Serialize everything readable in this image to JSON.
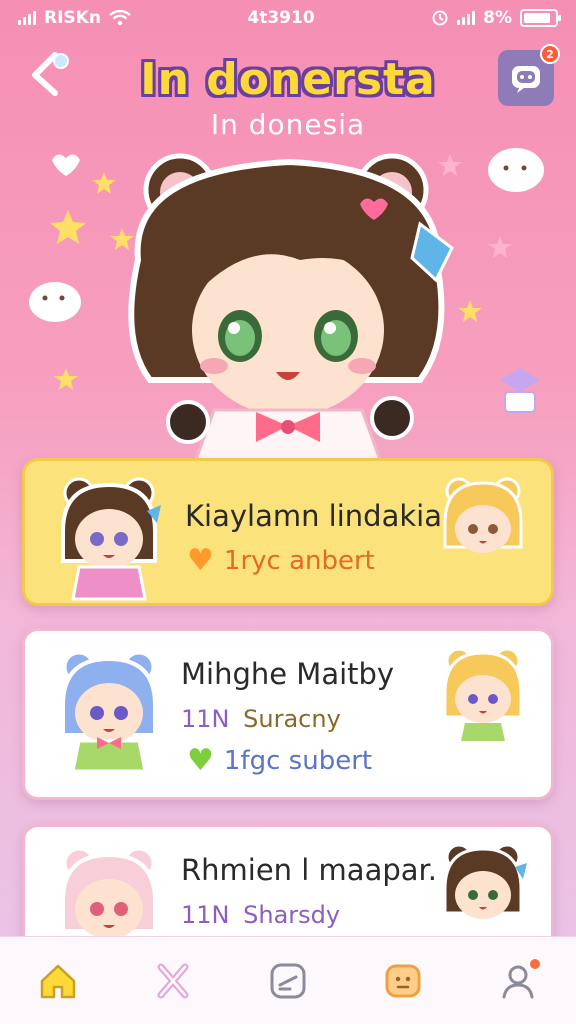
{
  "status_bar": {
    "carrier": "RISKn",
    "time": "4t3910",
    "battery": "8%"
  },
  "header": {
    "title": "In donersta",
    "subtitle": "In donesia",
    "notification_count": "2"
  },
  "cards": [
    {
      "name": "Kiaylamn lindakia",
      "meta": "1ryc anbert",
      "meta_icon": "orange-heart-icon",
      "accent": "#fbe27a"
    },
    {
      "name": "Mihghe Maitby",
      "line2_num": "11N",
      "line2_text": "Suracny",
      "meta": "1fgc subert",
      "meta_icon": "green-heart-icon",
      "accent": "#ffffff"
    },
    {
      "name": "Rhmien l maapar.",
      "line2_num": "11N",
      "line2_text": "Sharsdy",
      "accent": "#ffffff"
    }
  ],
  "tab_bar": {
    "items": [
      "home-icon",
      "sparkle-icon",
      "edit-icon",
      "face-icon",
      "profile-icon"
    ],
    "active": "home-icon"
  },
  "colors": {
    "background_top": "#f58fb4",
    "title_fill": "#ffd83a",
    "title_outline": "#6b3fa0",
    "card_highlight": "#fbe27a"
  }
}
